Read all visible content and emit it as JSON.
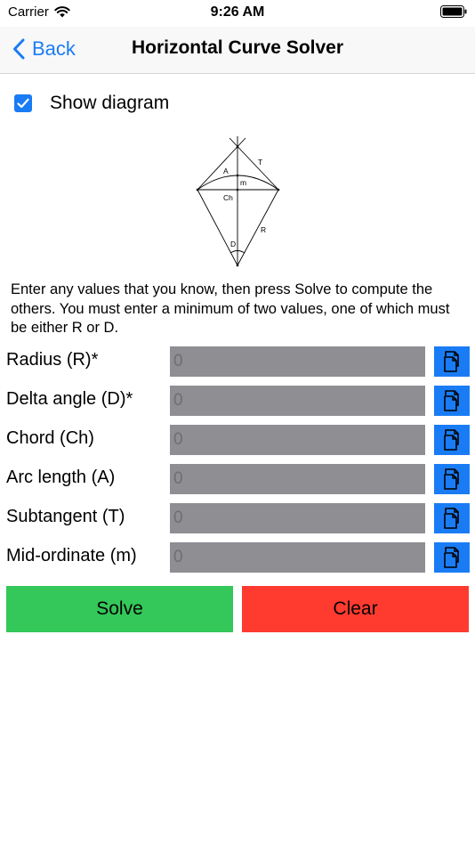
{
  "status_bar": {
    "carrier": "Carrier",
    "time": "9:26 AM"
  },
  "nav": {
    "back_label": "Back",
    "title": "Horizontal Curve Solver"
  },
  "show_diagram": {
    "label": "Show diagram",
    "checked": true
  },
  "diagram": {
    "labels": {
      "A": "A",
      "T": "T",
      "m": "m",
      "Ch": "Ch",
      "R": "R",
      "D": "D"
    }
  },
  "instructions": "Enter any values that you know, then press Solve to compute the others. You must enter a minimum of two values, one of which must be either R or D.",
  "fields": [
    {
      "label": "Radius (R)*",
      "placeholder": "0"
    },
    {
      "label": "Delta angle (D)*",
      "placeholder": "0"
    },
    {
      "label": "Chord (Ch)",
      "placeholder": "0"
    },
    {
      "label": "Arc length (A)",
      "placeholder": "0"
    },
    {
      "label": "Subtangent (T)",
      "placeholder": "0"
    },
    {
      "label": "Mid-ordinate (m)",
      "placeholder": "0"
    }
  ],
  "buttons": {
    "solve": "Solve",
    "clear": "Clear"
  },
  "colors": {
    "accent": "#1a7cf5",
    "solve": "#34c759",
    "clear": "#ff3b30",
    "input_bg": "#8e8e93"
  },
  "icons": {
    "paste": "paste-icon",
    "back": "chevron-left-icon",
    "wifi": "wifi-icon",
    "battery": "battery-icon",
    "checkbox": "checkmark-icon"
  }
}
